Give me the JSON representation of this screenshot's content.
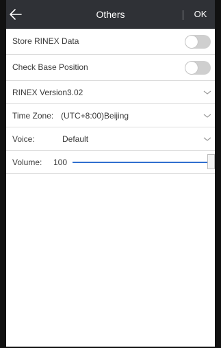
{
  "header": {
    "title": "Others",
    "ok_label": "OK"
  },
  "settings": {
    "store_rinex": {
      "label": "Store RINEX Data",
      "enabled": false
    },
    "check_base": {
      "label": "Check Base Position",
      "enabled": false
    },
    "rinex_version": {
      "label": "RINEX Version:",
      "value": "3.02"
    },
    "time_zone": {
      "label": "Time Zone:",
      "value": "(UTC+8:00)Beijing"
    },
    "voice": {
      "label": "Voice:",
      "value": "Default"
    },
    "volume": {
      "label": "Volume:",
      "value": "100",
      "level_percent": 100
    }
  },
  "colors": {
    "header_bg": "#2f3136",
    "accent": "#2f6fcf",
    "toggle_off": "#cfcfcf"
  }
}
